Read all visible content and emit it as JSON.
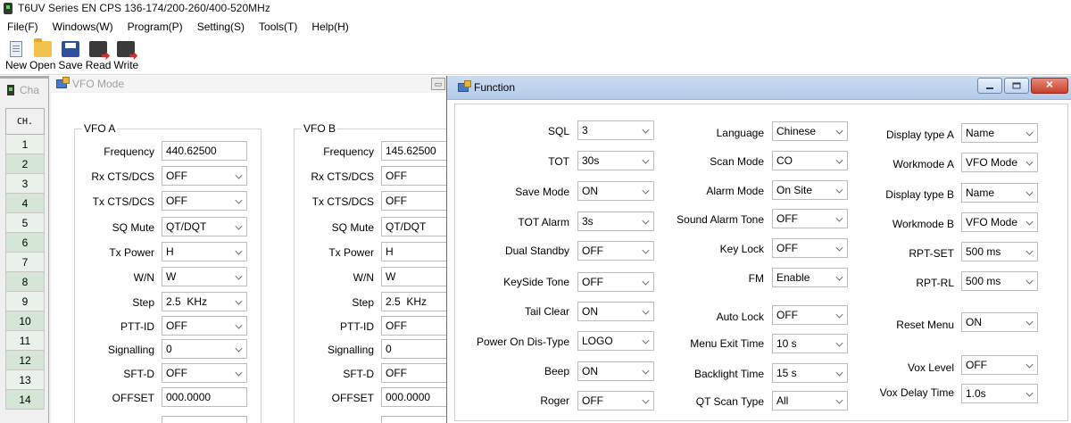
{
  "app": {
    "title": "T6UV Series EN CPS     136-174/200-260/400-520MHz"
  },
  "menu": [
    "File(F)",
    "Windows(W)",
    "Program(P)",
    "Setting(S)",
    "Tools(T)",
    "Help(H)"
  ],
  "toolbar": {
    "new": "New",
    "open": "Open",
    "save": "Save",
    "read": "Read",
    "write": "Write"
  },
  "channel_window": {
    "title": "Cha",
    "header": "CH.",
    "rows": [
      "1",
      "2",
      "3",
      "4",
      "5",
      "6",
      "7",
      "8",
      "9",
      "10",
      "11",
      "12",
      "13",
      "14"
    ]
  },
  "vfo_window": {
    "title": "VFO Mode",
    "vfo_a": {
      "title": "VFO A",
      "frequency_label": "Frequency",
      "frequency": "440.62500",
      "rx_cts_label": "Rx CTS/DCS",
      "rx_cts": "OFF",
      "tx_cts_label": "Tx CTS/DCS",
      "tx_cts": "OFF",
      "sq_mute_label": "SQ Mute",
      "sq_mute": "QT/DQT",
      "tx_power_label": "Tx Power",
      "tx_power": "H",
      "wn_label": "W/N",
      "wn": "W",
      "step_label": "Step",
      "step": "2.5  KHz",
      "ptt_id_label": "PTT-ID",
      "ptt_id": "OFF",
      "signalling_label": "Signalling",
      "signalling": "0",
      "sft_d_label": "SFT-D",
      "sft_d": "OFF",
      "offset_label": "OFFSET",
      "offset": "000.0000"
    },
    "vfo_b": {
      "title": "VFO B",
      "frequency_label": "Frequency",
      "frequency": "145.62500",
      "rx_cts_label": "Rx CTS/DCS",
      "rx_cts": "OFF",
      "tx_cts_label": "Tx CTS/DCS",
      "tx_cts": "OFF",
      "sq_mute_label": "SQ Mute",
      "sq_mute": "QT/DQT",
      "tx_power_label": "Tx Power",
      "tx_power": "H",
      "wn_label": "W/N",
      "wn": "W",
      "step_label": "Step",
      "step": "2.5  KHz",
      "ptt_id_label": "PTT-ID",
      "ptt_id": "OFF",
      "signalling_label": "Signalling",
      "signalling": "0",
      "sft_d_label": "SFT-D",
      "sft_d": "OFF",
      "offset_label": "OFFSET",
      "offset": "000.0000"
    }
  },
  "function_window": {
    "title": "Function",
    "col1": {
      "sql_label": "SQL",
      "sql": "3",
      "tot_label": "TOT",
      "tot": "30s",
      "save_mode_label": "Save Mode",
      "save_mode": "ON",
      "tot_alarm_label": "TOT Alarm",
      "tot_alarm": "3s",
      "dual_standby_label": "Dual Standby",
      "dual_standby": "OFF",
      "keyside_tone_label": "KeySide Tone",
      "keyside_tone": "OFF",
      "tail_clear_label": "Tail Clear",
      "tail_clear": "ON",
      "power_on_label": "Power On Dis-Type",
      "power_on": "LOGO",
      "beep_label": "Beep",
      "beep": "ON",
      "roger_label": "Roger",
      "roger": "OFF"
    },
    "col2": {
      "language_label": "Language",
      "language": "Chinese",
      "scan_mode_label": "Scan Mode",
      "scan_mode": "CO",
      "alarm_mode_label": "Alarm Mode",
      "alarm_mode": "On Site",
      "sound_alarm_label": "Sound Alarm Tone",
      "sound_alarm": "OFF",
      "key_lock_label": "Key Lock",
      "key_lock": "OFF",
      "fm_label": "FM",
      "fm": "Enable",
      "auto_lock_label": "Auto Lock",
      "auto_lock": "OFF",
      "menu_exit_label": "Menu Exit Time",
      "menu_exit": "10 s",
      "backlight_label": "Backlight Time",
      "backlight": "15 s",
      "qt_scan_label": "QT Scan Type",
      "qt_scan": "All"
    },
    "col3": {
      "display_a_label": "Display type A",
      "display_a": "Name",
      "workmode_a_label": "Workmode A",
      "workmode_a": "VFO Mode",
      "display_b_label": "Display type B",
      "display_b": "Name",
      "workmode_b_label": "Workmode B",
      "workmode_b": "VFO Mode",
      "rpt_set_label": "RPT-SET",
      "rpt_set": "500 ms",
      "rpt_rl_label": "RPT-RL",
      "rpt_rl": "500 ms",
      "reset_menu_label": "Reset Menu",
      "reset_menu": "ON",
      "vox_level_label": "Vox Level",
      "vox_level": "OFF",
      "vox_delay_label": "Vox Delay Time",
      "vox_delay": "1.0s"
    }
  }
}
